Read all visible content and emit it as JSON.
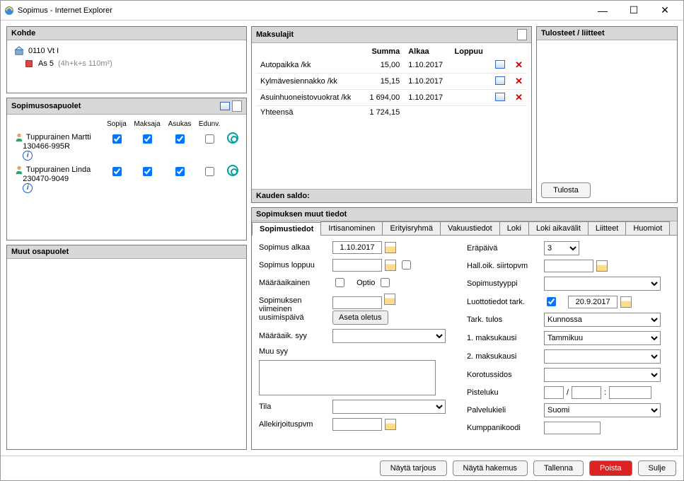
{
  "window": {
    "title": "Sopimus - Internet Explorer"
  },
  "kohde": {
    "title": "Kohde",
    "addr1": "0110 Vt I",
    "addr2": "As 5",
    "details": "(4h+k+s  110m²)"
  },
  "parties": {
    "title": "Sopimusosapuolet",
    "columns": {
      "sopija": "Sopija",
      "maksaja": "Maksaja",
      "asukas": "Asukas",
      "edunv": "Edunv."
    },
    "rows": [
      {
        "name": "Tuppurainen Martti",
        "id": "130466-995R",
        "sopija": true,
        "maksaja": true,
        "asukas": true,
        "edunv": false
      },
      {
        "name": "Tuppurainen Linda",
        "id": "230470-9049",
        "sopija": true,
        "maksaja": true,
        "asukas": true,
        "edunv": false
      }
    ]
  },
  "muut": {
    "title": "Muut osapuolet"
  },
  "maksulajit": {
    "title": "Maksulajit",
    "columns": {
      "summa": "Summa",
      "alkaa": "Alkaa",
      "loppuu": "Loppuu"
    },
    "rows": [
      {
        "name": "Autopaikka /kk",
        "summa": "15,00",
        "alkaa": "1.10.2017",
        "loppuu": ""
      },
      {
        "name": "Kylmävesiennakko /kk",
        "summa": "15,15",
        "alkaa": "1.10.2017",
        "loppuu": ""
      },
      {
        "name": "Asuinhuoneistovuokrat /kk",
        "summa": "1 694,00",
        "alkaa": "1.10.2017",
        "loppuu": ""
      }
    ],
    "total_label": "Yhteensä",
    "total_value": "1 724,15",
    "kauden": "Kauden saldo:"
  },
  "tulosteet": {
    "title": "Tulosteet / liitteet",
    "print_btn": "Tulosta"
  },
  "details": {
    "title": "Sopimuksen muut tiedot",
    "tabs": [
      "Sopimustiedot",
      "Irtisanominen",
      "Erityisryhmä",
      "Vakuustiedot",
      "Loki",
      "Loki aikavälit",
      "Liitteet",
      "Huomiot"
    ],
    "left": {
      "sopimus_alkaa": "Sopimus alkaa",
      "sopimus_alkaa_val": "1.10.2017",
      "sopimus_loppuu": "Sopimus loppuu",
      "maaraaikainen": "Määräaikainen",
      "optio": "Optio",
      "uusimispaiva": "Sopimuksen viimeinen uusimispäivä",
      "aseta_oletus": "Aseta oletus",
      "maaraik_syy": "Määräaik. syy",
      "muu_syy": "Muu syy",
      "tila": "Tila",
      "allekirjoitus": "Allekirjoituspvm"
    },
    "right": {
      "erapaiva": "Eräpäivä",
      "erapaiva_val": "3",
      "halloik": "Hall.oik. siirtopvm",
      "sopimustyyppi": "Sopimustyyppi",
      "luottotiedot": "Luottotiedot tark.",
      "luottotiedot_val": "20.9.2017",
      "tark_tulos": "Tark. tulos",
      "tark_tulos_val": "Kunnossa",
      "maksukausi1": "1. maksukausi",
      "maksukausi1_val": "Tammikuu",
      "maksukausi2": "2. maksukausi",
      "korotussidos": "Korotussidos",
      "pisteluku": "Pisteluku",
      "palvelukieli": "Palvelukieli",
      "palvelukieli_val": "Suomi",
      "kumppanikoodi": "Kumppanikoodi"
    }
  },
  "footer": {
    "nayta_tarjous": "Näytä tarjous",
    "nayta_hakemus": "Näytä hakemus",
    "tallenna": "Tallenna",
    "poista": "Poista",
    "sulje": "Sulje"
  }
}
